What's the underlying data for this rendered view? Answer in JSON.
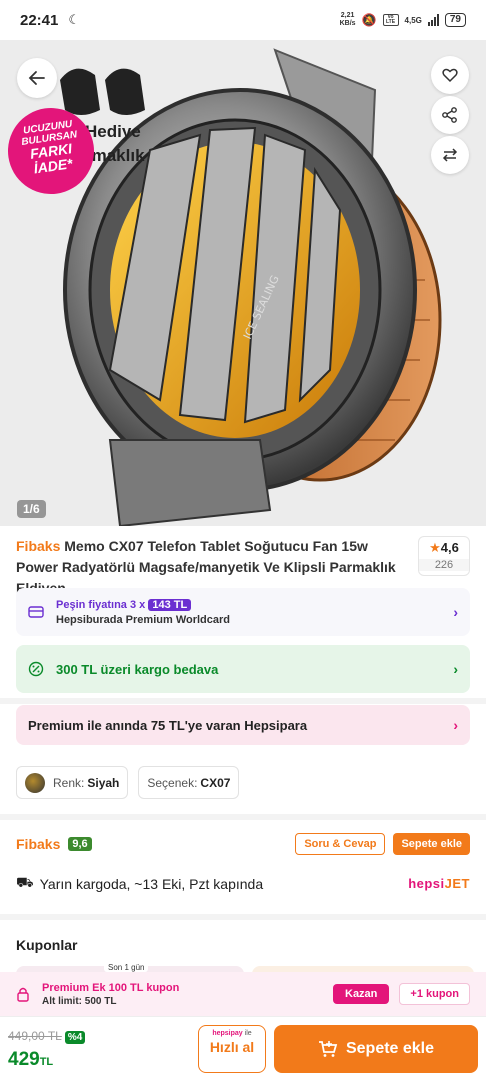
{
  "status_bar": {
    "time": "22:41",
    "net_speed_value": "2,21",
    "net_speed_unit": "KB/s",
    "volte_label": "Vo LTE",
    "network": "4,5G",
    "battery": "79"
  },
  "hero": {
    "gift_line1": "Hediye",
    "gift_line2": "rmaklık",
    "badge_line1": "UCUZUNU",
    "badge_line2": "BULURSAN",
    "badge_line3": "FARKI",
    "badge_line4": "İADE*",
    "image_text": "ICE SEALING",
    "page_indicator": "1/6"
  },
  "product": {
    "brand": "Fibaks",
    "title": " Memo CX07 Telefon Tablet Soğutucu Fan 15w Power Radyatörlü Magsafe/manyetik Ve Klipsli Parmaklık Eldiven",
    "rating": "4,6",
    "review_count": "226"
  },
  "worldcard": {
    "label_prefix": "Peşin fiyatına 3 x",
    "amount": "143 TL",
    "label2": "Hepsiburada Premium Worldcard"
  },
  "cargo": {
    "label": "300 TL üzeri kargo bedava"
  },
  "hepsipara": {
    "label": "Premium ile anında 75 TL'ye varan Hepsipara"
  },
  "variants": {
    "color_key": "Renk:",
    "color_value": "Siyah",
    "option_key": "Seçenek:",
    "option_value": "CX07"
  },
  "seller": {
    "name": "Fibaks",
    "score": "9,6",
    "qa_label": "Soru & Cevap",
    "add_cart_label": "Sepete ekle"
  },
  "delivery": {
    "text": "Yarın kargoda, ~13 Eki, Pzt kapında",
    "carrier_a": "hepsi",
    "carrier_b": "JET"
  },
  "coupons": {
    "title": "Kuponlar",
    "tag": "Son 1 gün",
    "bar_title": "Premium Ek 100 TL kupon",
    "bar_sub": "Alt limit: 500 TL",
    "earn_label": "Kazan",
    "more_label": "+1 kupon"
  },
  "purchase": {
    "old_price": "449,00 TL",
    "discount": "%4",
    "price": "429",
    "currency": "TL",
    "fast_brand": "hepsipay",
    "fast_with": "ile",
    "fast_label": "Hızlı al",
    "add_label": "Sepete ekle"
  },
  "colors": {
    "accent_orange": "#f27a1a",
    "brand_pink": "#e3157a",
    "success_green": "#0a8a2a",
    "premium_purple": "#6b2fd1"
  }
}
